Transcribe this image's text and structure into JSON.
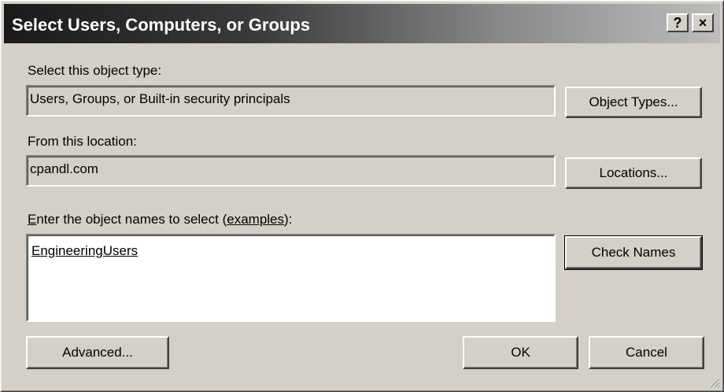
{
  "window": {
    "title": "Select Users, Computers, or Groups",
    "help_label": "?",
    "close_label": "×"
  },
  "object_type": {
    "label": "Select this object type:",
    "value": "Users, Groups, or Built-in security principals",
    "button": "Object Types..."
  },
  "location": {
    "label": "From this location:",
    "value": "cpandl.com",
    "button": "Locations..."
  },
  "names": {
    "label_prefix_letter": "E",
    "label_middle": "nter the object names to select (",
    "label_link": "examples",
    "label_suffix": "):",
    "value": "EngineeringUsers",
    "button": "Check Names"
  },
  "footer": {
    "advanced": "Advanced...",
    "ok": "OK",
    "cancel": "Cancel"
  }
}
